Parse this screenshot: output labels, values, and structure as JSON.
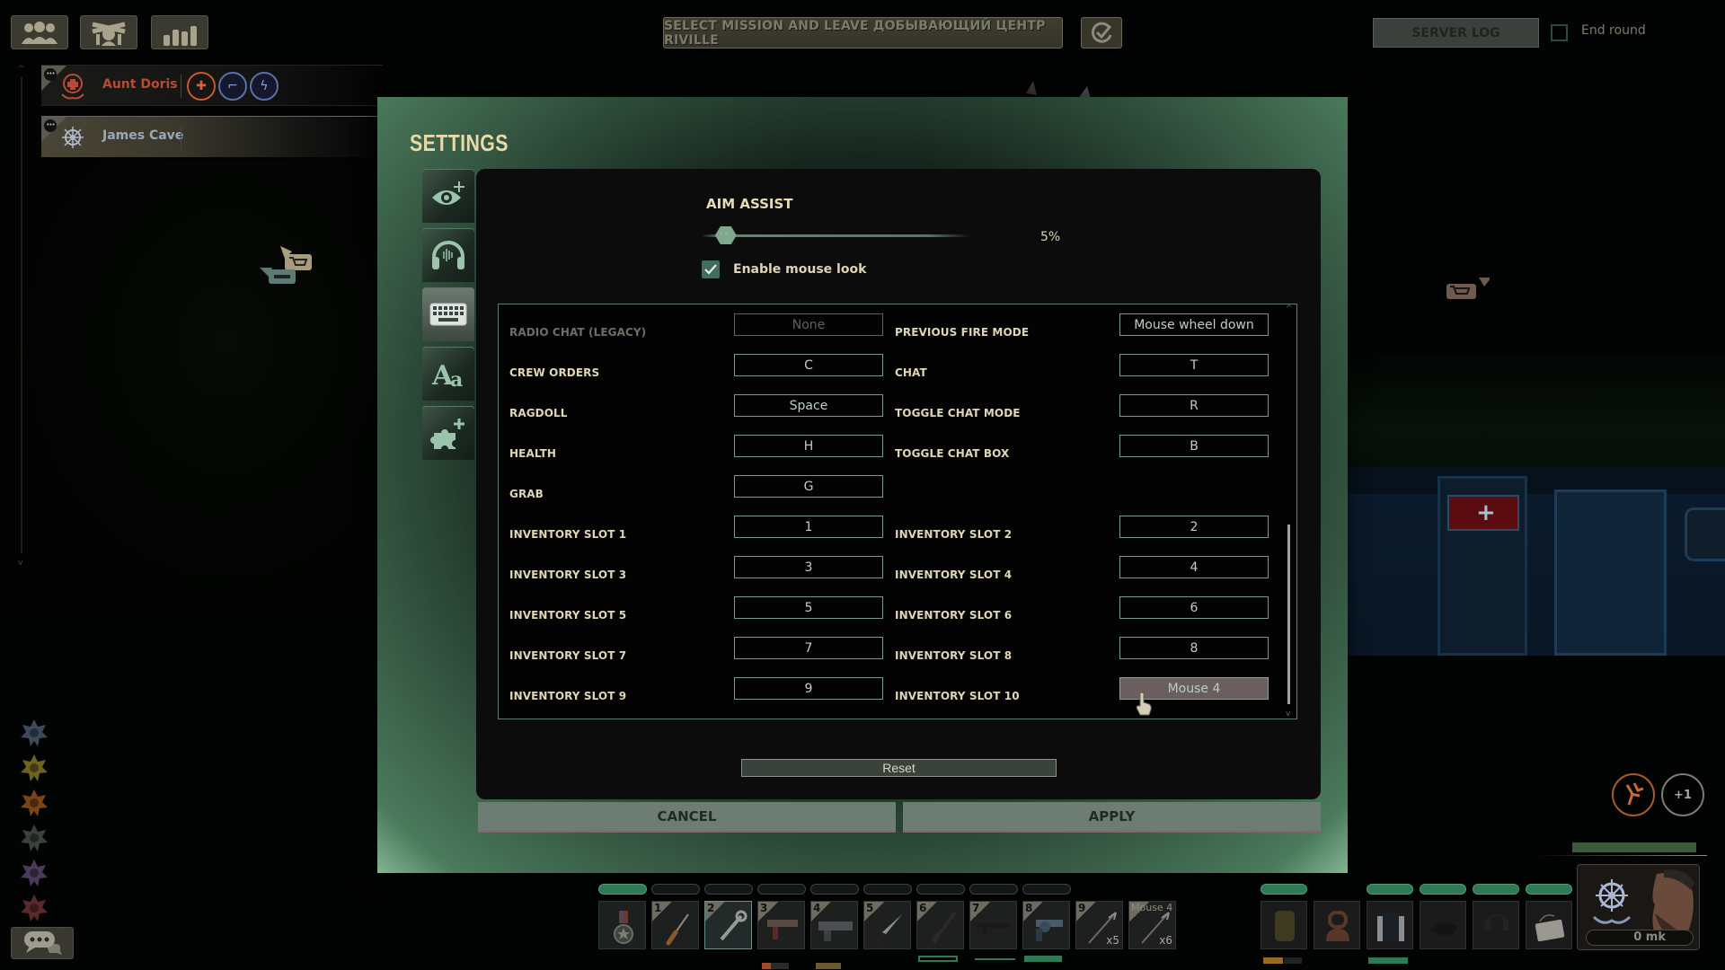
{
  "top_toolbar": {
    "buttons": [
      {
        "icon": "crew-icon"
      },
      {
        "icon": "commands-icon"
      },
      {
        "icon": "stats-icon"
      }
    ],
    "mission_button": "SELECT MISSION AND LEAVE ДОБЫВАЮЩИЙ ЦЕНТР RIVILLE",
    "ready_icon": "check-circle-icon",
    "server_log": "SERVER LOG",
    "end_round": {
      "label": "End round",
      "checked": false
    }
  },
  "crew": [
    {
      "name": "Aunt Doris",
      "job": "medic",
      "name_color": "#b84a36",
      "talents": [
        "medical-diamond-icon",
        "mechanic-icon",
        "electric-icon"
      ]
    },
    {
      "name": "James Cave",
      "job": "captain",
      "name_color": "#9aa8b8",
      "talents": []
    }
  ],
  "settings": {
    "title": "SETTINGS",
    "tabs": [
      {
        "icon": "graphics-eye-icon",
        "active": false
      },
      {
        "icon": "audio-headphones-icon",
        "active": false
      },
      {
        "icon": "controls-keyboard-icon",
        "active": true
      },
      {
        "icon": "language-text-icon",
        "active": false
      },
      {
        "icon": "mods-puzzle-icon",
        "active": false
      }
    ],
    "aim_assist": {
      "label": "AIM ASSIST",
      "value_text": "5%",
      "value": 0.05
    },
    "mouse_look": {
      "label": "Enable mouse look",
      "checked": true
    },
    "bindings_left": [
      {
        "label": "RADIO CHAT (LEGACY)",
        "key": "None",
        "disabled": true
      },
      {
        "label": "CREW ORDERS",
        "key": "C"
      },
      {
        "label": "RAGDOLL",
        "key": "Space"
      },
      {
        "label": "HEALTH",
        "key": "H"
      },
      {
        "label": "GRAB",
        "key": "G"
      },
      {
        "label": "INVENTORY SLOT 1",
        "key": "1"
      },
      {
        "label": "INVENTORY SLOT 3",
        "key": "3"
      },
      {
        "label": "INVENTORY SLOT 5",
        "key": "5"
      },
      {
        "label": "INVENTORY SLOT 7",
        "key": "7"
      },
      {
        "label": "INVENTORY SLOT 9",
        "key": "9"
      }
    ],
    "bindings_right": [
      {
        "label": "PREVIOUS FIRE MODE",
        "key": "Mouse wheel down"
      },
      {
        "label": "CHAT",
        "key": "T"
      },
      {
        "label": "TOGGLE CHAT MODE",
        "key": "R"
      },
      {
        "label": "TOGGLE CHAT BOX",
        "key": "B"
      },
      null,
      {
        "label": "INVENTORY SLOT 2",
        "key": "2"
      },
      {
        "label": "INVENTORY SLOT 4",
        "key": "4"
      },
      {
        "label": "INVENTORY SLOT 6",
        "key": "6"
      },
      {
        "label": "INVENTORY SLOT 8",
        "key": "8"
      },
      {
        "label": "INVENTORY SLOT 10",
        "key": "Mouse 4",
        "hovered": true
      }
    ],
    "reset": "Reset",
    "cancel": "CANCEL",
    "apply": "APPLY"
  },
  "hotbar": {
    "slots": [
      {
        "num": "",
        "item": "medal",
        "count": ""
      },
      {
        "num": "1",
        "item": "screwdriver",
        "count": ""
      },
      {
        "num": "2",
        "item": "wrench",
        "count": "",
        "selected": true
      },
      {
        "num": "3",
        "item": "smg",
        "count": ""
      },
      {
        "num": "4",
        "item": "shotgun",
        "count": ""
      },
      {
        "num": "5",
        "item": "knife",
        "count": ""
      },
      {
        "num": "6",
        "item": "rifle",
        "count": ""
      },
      {
        "num": "7",
        "item": "pistol",
        "count": ""
      },
      {
        "num": "8",
        "item": "revolver",
        "count": ""
      },
      {
        "num": "9",
        "item": "harpoon",
        "count": "x5"
      },
      {
        "num": "Mouse 4",
        "item": "harpoon",
        "count": "x6"
      }
    ]
  },
  "equipment": {
    "slots": [
      "backpack",
      "helmet",
      "body-armor",
      "cap",
      "headset",
      "id-card"
    ]
  },
  "character": {
    "money": "0 mk",
    "affliction_icon": "bleeding-icon",
    "extra_afflictions": "+1"
  },
  "ranks": [
    "blue",
    "yellow",
    "orange",
    "grey",
    "purple",
    "red"
  ],
  "colors": {
    "accent_green": "#2f7a55",
    "modal_glow": "#82b591",
    "title_text": "#e7d9a8",
    "medic_red": "#b84a36"
  }
}
